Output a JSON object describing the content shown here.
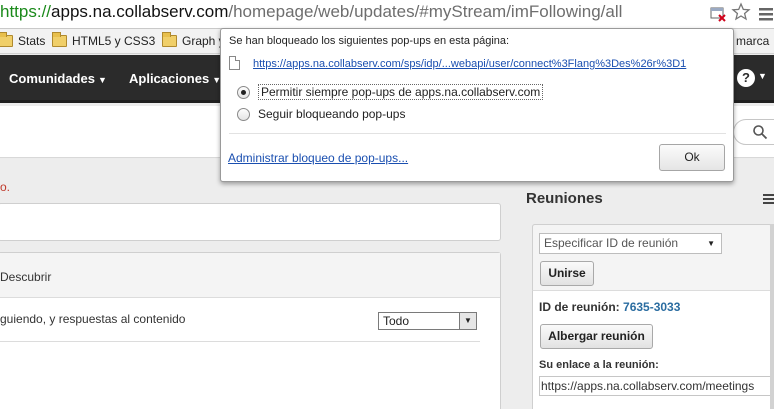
{
  "address_bar": {
    "scheme": "https://",
    "host": "apps.na.collabserv.com",
    "path": "/homepage/web/updates/#myStream/imFollowing/all"
  },
  "bookmarks": [
    {
      "label": "Stats",
      "icon": "folder-icon"
    },
    {
      "label": "HTML5 y CSS3",
      "icon": "folder-icon"
    },
    {
      "label": "Graph y",
      "icon": "folder-icon"
    },
    {
      "label": "os marca",
      "icon": "folder-icon"
    }
  ],
  "navbar": {
    "items": [
      {
        "label": "Comunidades"
      },
      {
        "label": "Aplicaciones"
      }
    ],
    "help_label": "?"
  },
  "main": {
    "hint": "o.",
    "panel_title": "Descubrir",
    "panel_desc": "guiendo, y respuestas al contenido",
    "filter_value": "Todo"
  },
  "meetings": {
    "title": "Reuniones",
    "id_placeholder": "Especificar ID de reunión",
    "join_label": "Unirse",
    "id_label": "ID de reunión:",
    "id_value": "7635-3033",
    "host_label": "Albergar reunión",
    "link_label": "Su enlace a la reunión:",
    "link_value": "https://apps.na.collabserv.com/meetings"
  },
  "popup": {
    "title": "Se han bloqueado los siguientes pop-ups en esta página:",
    "blocked_url": "https://apps.na.collabserv.com/sps/idp/...webapi/user/connect%3Flang%3Des%26r%3D1",
    "option_allow": "Permitir siempre pop-ups de apps.na.collabserv.com",
    "option_block": "Seguir bloqueando pop-ups",
    "selected_option": "allow",
    "manage_link": "Administrar bloqueo de pop-ups...",
    "ok_label": "Ok"
  },
  "colors": {
    "navbar_bg": "#2b2b2b",
    "link_blue": "#1a4fb0",
    "secure_green": "#1b8a1b",
    "meeting_id": "#2a6ca0",
    "hint_red": "#c0392b"
  }
}
